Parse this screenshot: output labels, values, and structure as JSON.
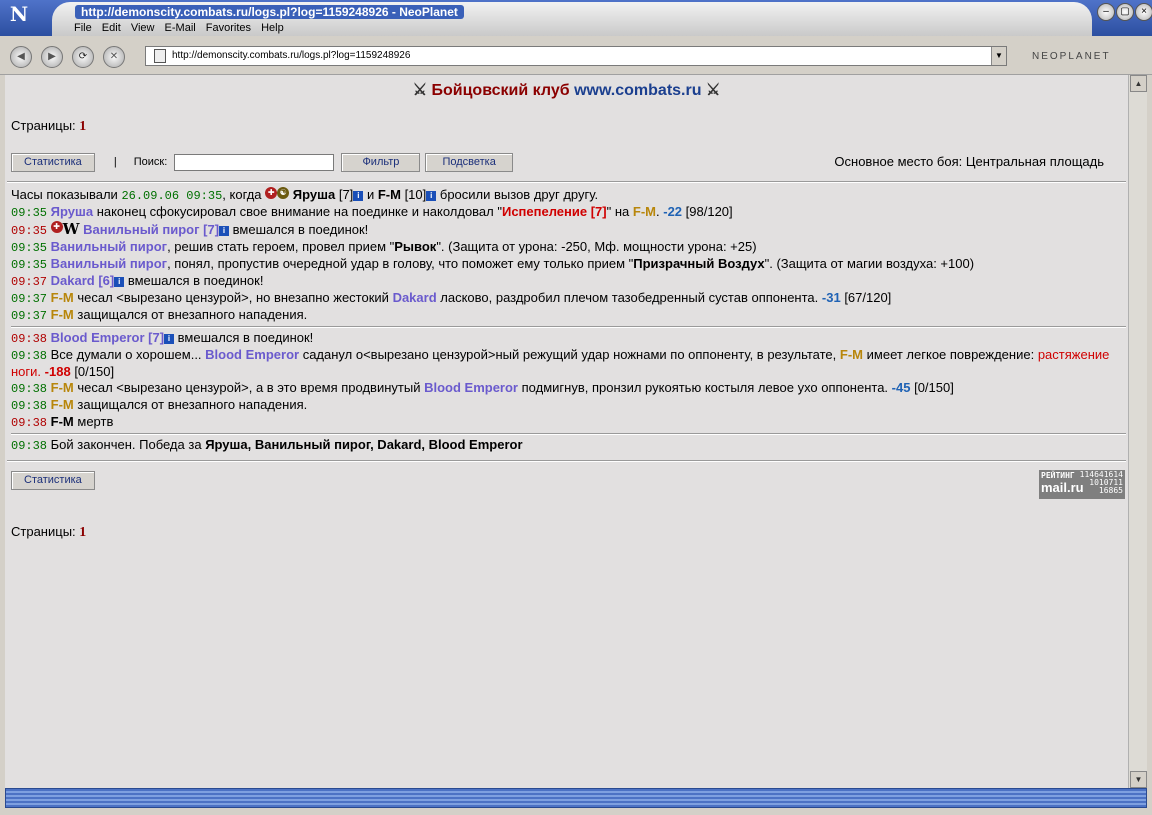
{
  "window": {
    "title": "http://demonscity.combats.ru/logs.pl?log=1159248926 - NeoPlanet",
    "menu": [
      "File",
      "Edit",
      "View",
      "E-Mail",
      "Favorites",
      "Help"
    ],
    "address": "http://demonscity.combats.ru/logs.pl?log=1159248926",
    "brand": "NEOPLANET"
  },
  "page": {
    "header_part1": "Бойцовский клуб",
    "header_part2": "www.combats.ru",
    "pages_label": "Страницы:",
    "pages_num": "1",
    "stats_btn": "Статистика",
    "pipe": "|",
    "search_label": "Поиск:",
    "search_value": "",
    "filter_btn": "Фильтр",
    "highlight_btn": "Подсветка",
    "place": "Основное место боя: Центральная площадь"
  },
  "log": {
    "l0": {
      "a": "Часы показывали",
      "time": "26.09.06 09:35",
      "b": ", когда",
      "p1": "Яруша",
      "lvl1": "[7]",
      "and": "и",
      "p2": "F-M",
      "lvl2": "[10]",
      "c": "бросили вызов друг другу."
    },
    "l1": {
      "time": "09:35",
      "p": "Яруша",
      "a": "наконец сфокусировал свое внимание на поединке и наколдовал \"",
      "spell": "Испепеление [7]",
      "b": "\" на",
      "t": "F-M",
      "dmg": "-22",
      "hp": "[98/120]"
    },
    "l2": {
      "time": "09:35",
      "p": "Ванильный пирог [7]",
      "a": "вмешался в поединок!"
    },
    "l3": {
      "time": "09:35",
      "p": "Ванильный пирог",
      "a": ", решив стать героем, провел прием \"",
      "skill": "Рывок",
      "b": "\". (Защита от урона: -250, Мф. мощности урона: +25)"
    },
    "l4": {
      "time": "09:35",
      "p": "Ванильный пирог",
      "a": ", понял, пропустив очередной удар в голову, что поможет ему только прием \"",
      "skill": "Призрачный Воздух",
      "b": "\". (Защита от магии воздуха: +100)"
    },
    "l5": {
      "time": "09:37",
      "p": "Dakard [6]",
      "a": "вмешался в поединок!"
    },
    "l6": {
      "time": "09:37",
      "p": "F-M",
      "a": "чесал <вырезано цензурой>, но внезапно жестокий",
      "p2": "Dakard",
      "b": "ласково, раздробил плечом тазобедренный сустав оппонента.",
      "dmg": "-31",
      "hp": "[67/120]"
    },
    "l7": {
      "time": "09:37",
      "p": "F-M",
      "a": "защищался от внезапного нападения."
    },
    "l8": {
      "time": "09:38",
      "p": "Blood Emperor [7]",
      "a": "вмешался в поединок!"
    },
    "l9": {
      "time": "09:38",
      "a": "Все думали о хорошем...",
      "p": "Blood Emperor",
      "b": "саданул о<вырезано цензурой>ный режущий удар ножнами по оппоненту, в результате,",
      "t": "F-M",
      "c": "имеет легкое повреждение:",
      "inj": "растяжение ноги.",
      "dmg": "-188",
      "hp": "[0/150]"
    },
    "l10": {
      "time": "09:38",
      "p": "F-M",
      "a": "чесал <вырезано цензурой>, а в это время продвинутый",
      "p2": "Blood Emperor",
      "b": "подмигнув, пронзил рукоятью костыля левое ухо оппонента.",
      "dmg": "-45",
      "hp": "[0/150]"
    },
    "l11": {
      "time": "09:38",
      "p": "F-M",
      "a": "защищался от внезапного нападения."
    },
    "l12": {
      "time": "09:38",
      "p": "F-M",
      "a": "мертв"
    },
    "l13": {
      "time": "09:38",
      "a": "Бой закончен. Победа за",
      "winners": "Яруша, Ванильный пирог, Dakard, Blood Emperor"
    }
  },
  "counter": {
    "label": "РЕЙТИНГ",
    "site": "mail.ru",
    "n1": "114641614",
    "n2": "1010711",
    "n3": "16865"
  },
  "colors": {
    "accent": "#8b0000",
    "link": "#6a5acd",
    "enemy": "#b8860b"
  }
}
